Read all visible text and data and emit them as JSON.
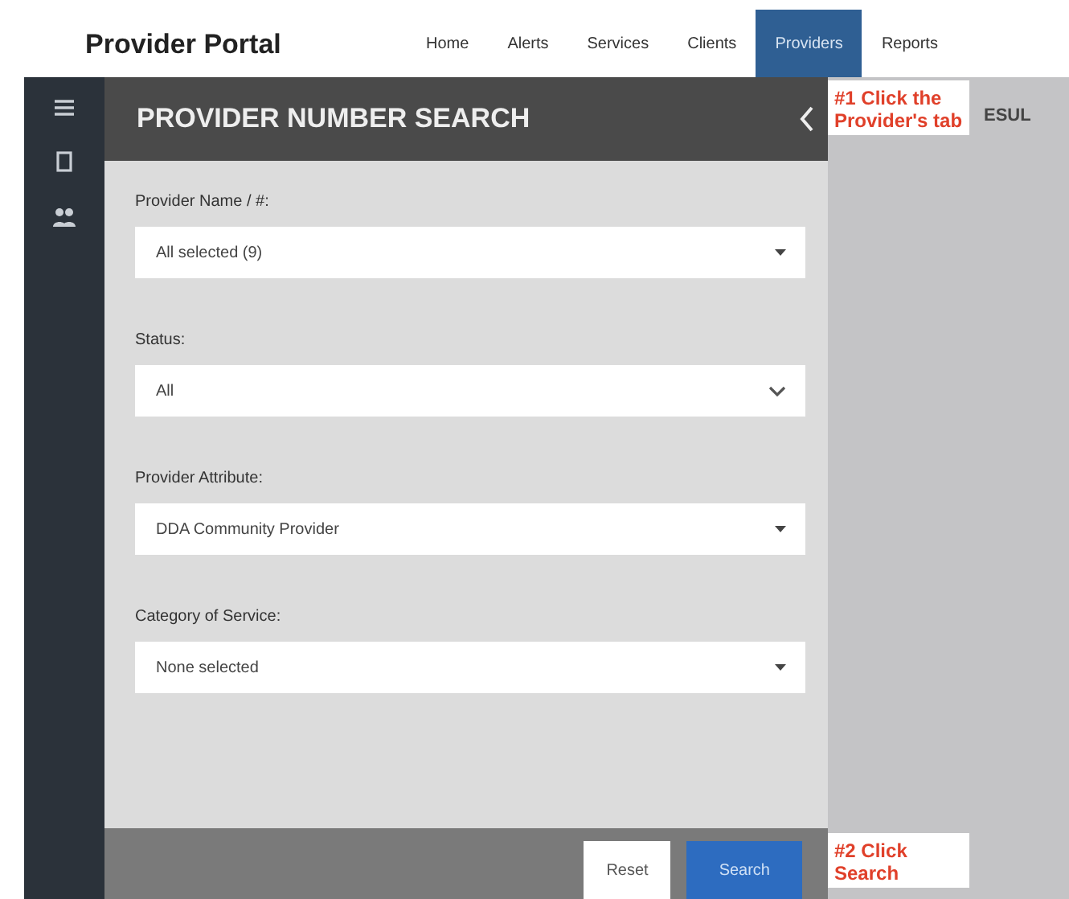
{
  "brand": "Provider Portal",
  "nav": [
    {
      "label": "Home",
      "selected": false
    },
    {
      "label": "Alerts",
      "selected": false
    },
    {
      "label": "Services",
      "selected": false
    },
    {
      "label": "Clients",
      "selected": false
    },
    {
      "label": "Providers",
      "selected": true
    },
    {
      "label": "Reports",
      "selected": false
    }
  ],
  "panel": {
    "title": "PROVIDER NUMBER SEARCH",
    "fields": [
      {
        "label": "Provider Name / #:",
        "value": "All selected (9)",
        "kind": "multi"
      },
      {
        "label": "Status:",
        "value": "All",
        "kind": "select"
      },
      {
        "label": "Provider Attribute:",
        "value": "DDA Community Provider",
        "kind": "multi"
      },
      {
        "label": "Category of Service:",
        "value": "None selected",
        "kind": "multi"
      }
    ],
    "buttons": [
      {
        "label": "Reset",
        "kind": "secondary"
      },
      {
        "label": "Search",
        "kind": "primary"
      }
    ]
  },
  "results_heading": "ESUL",
  "annotations": [
    "#1 Click the Provider's tab",
    "#2 Click Search"
  ]
}
